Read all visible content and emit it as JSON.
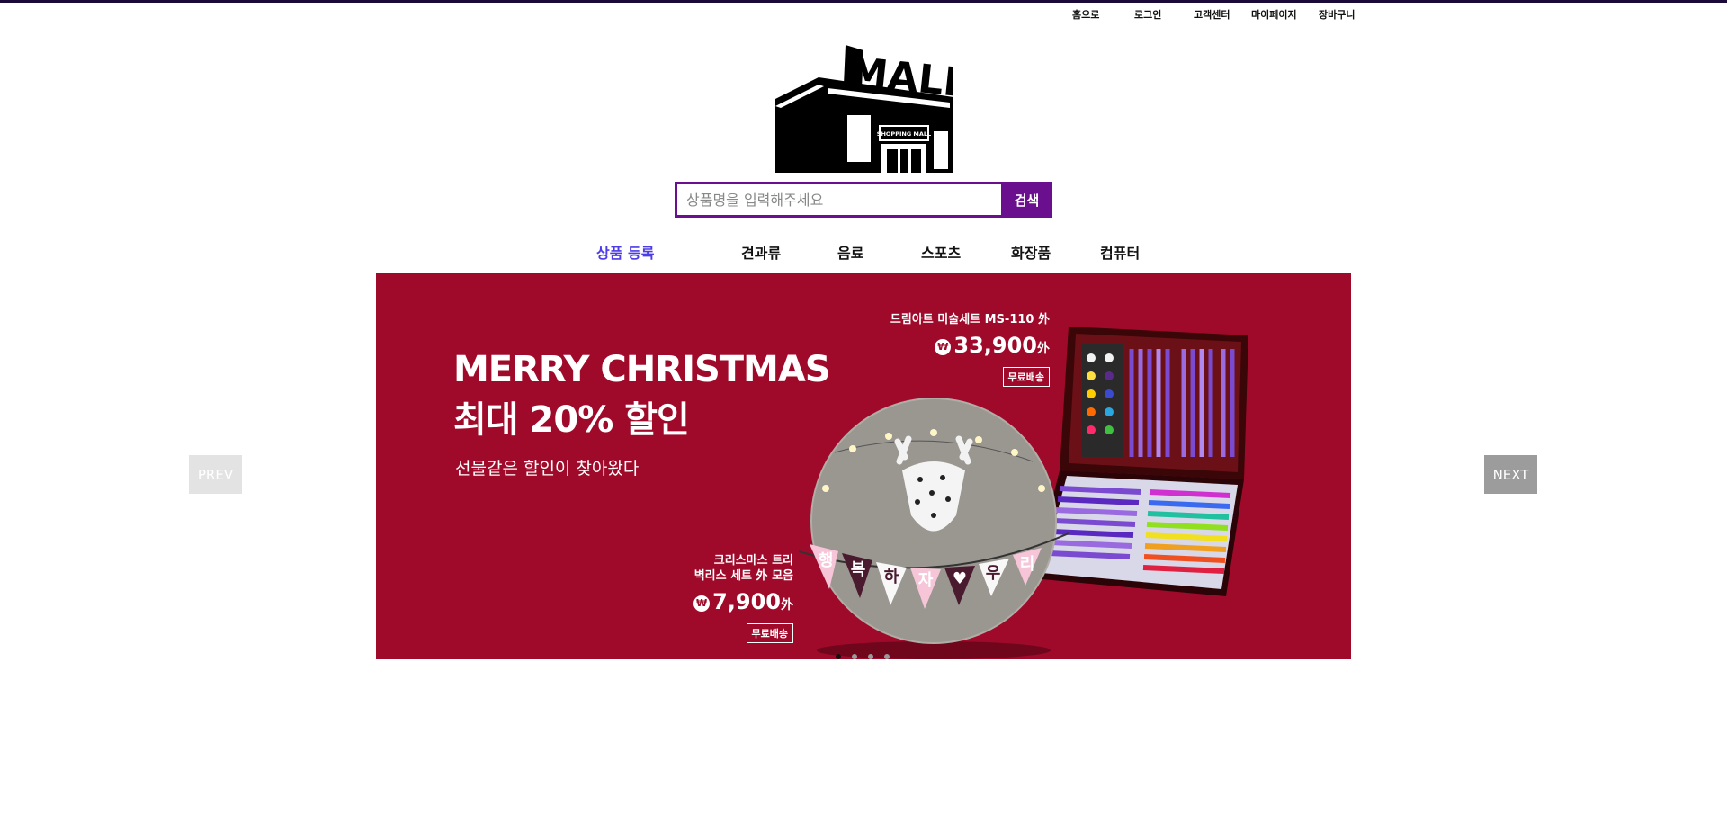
{
  "top_nav": {
    "home": "홈으로",
    "login": "로그인",
    "support": "고객센터",
    "mypage": "마이페이지",
    "cart": "장바구니"
  },
  "logo": {
    "text": "MALL",
    "sign": "SHOPPING MALL"
  },
  "search": {
    "placeholder": "상품명을 입력해주세요",
    "button": "검색"
  },
  "menu": [
    {
      "label": "상품 등록",
      "active": true
    },
    {
      "label": "견과류"
    },
    {
      "label": "음료"
    },
    {
      "label": "스포츠"
    },
    {
      "label": "화장품"
    },
    {
      "label": "컴퓨터"
    }
  ],
  "banner": {
    "title_line1": "MERRY CHRISTMAS",
    "title_line2": "최대 20% 할인",
    "subtitle": "선물같은 할인이 찾아왔다",
    "background": "#a00a2a",
    "promo1": {
      "name": "드림아트 미술세트 MS-110 外",
      "currency": "₩",
      "price": "33,900",
      "suffix": "外",
      "ship": "무료배송"
    },
    "promo2": {
      "name_line1": "크리스마스 트리",
      "name_line2": "벽리스 세트 外 모음",
      "currency": "₩",
      "price": "7,900",
      "suffix": "外",
      "ship": "무료배송"
    },
    "bunting": [
      "행",
      "복",
      "하",
      "자",
      "♥",
      "우",
      "리"
    ]
  },
  "carousel": {
    "prev": "PREV",
    "next": "NEXT",
    "dot_count": 4,
    "active_dot": 0
  },
  "colors": {
    "brand": "#6a0f8e",
    "active_menu": "#4c3de6",
    "banner_bg": "#a00a2a"
  }
}
